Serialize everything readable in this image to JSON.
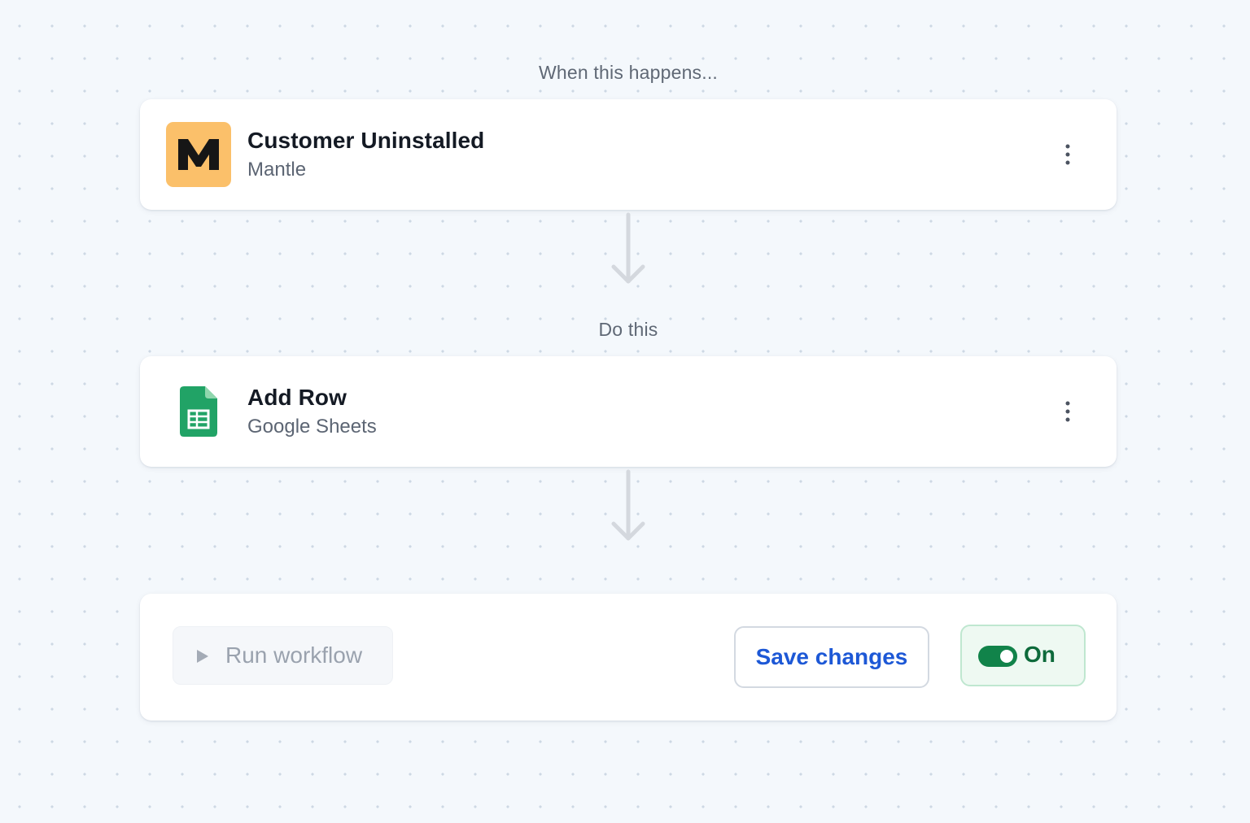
{
  "trigger": {
    "section_label": "When this happens...",
    "title": "Customer Uninstalled",
    "app": "Mantle",
    "icon": "mantle-logo-icon",
    "icon_color": "#fbc06a"
  },
  "action": {
    "section_label": "Do this",
    "title": "Add Row",
    "app": "Google Sheets",
    "icon": "google-sheets-icon",
    "icon_color": "#21a366"
  },
  "footer": {
    "run_label": "Run workflow",
    "save_label": "Save changes",
    "toggle_label": "On",
    "toggle_state": true,
    "accent_color": "#1d58d6",
    "toggle_color": "#11834a"
  }
}
